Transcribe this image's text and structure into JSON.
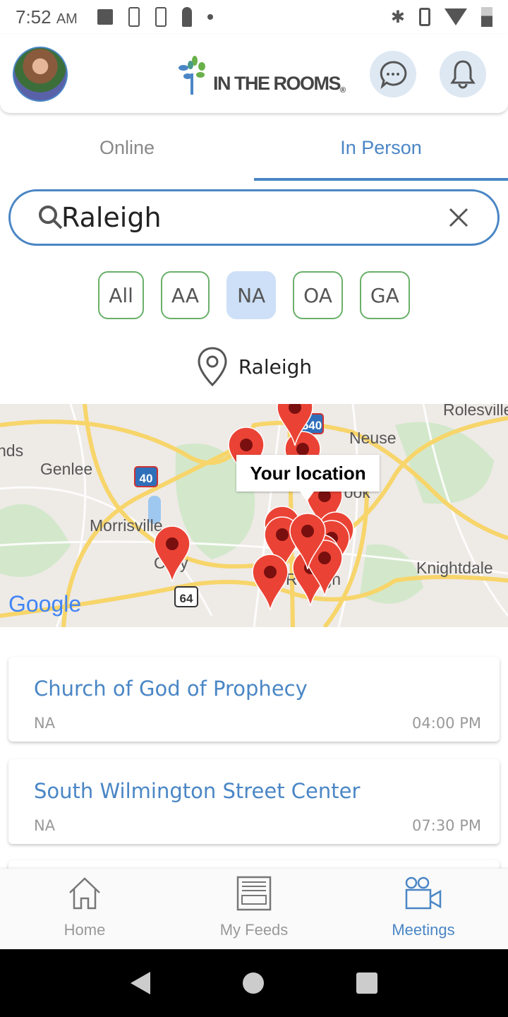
{
  "status_bar": {
    "time": "7:52",
    "ampm": "AM"
  },
  "header": {
    "logo_text": "IN THE ROOMS",
    "logo_mark": "®"
  },
  "tabs": [
    {
      "label": "Online",
      "active": false
    },
    {
      "label": "In Person",
      "active": true
    }
  ],
  "search": {
    "value": "Raleigh",
    "placeholder": ""
  },
  "filters": [
    {
      "label": "All",
      "selected": false
    },
    {
      "label": "AA",
      "selected": false
    },
    {
      "label": "NA",
      "selected": true
    },
    {
      "label": "OA",
      "selected": false
    },
    {
      "label": "GA",
      "selected": false
    }
  ],
  "location": {
    "label": "Raleigh"
  },
  "map": {
    "tooltip": "Your location",
    "places": [
      "Rolesville",
      "Neuse",
      "nds",
      "Genlee",
      "Morrisville",
      "Cary",
      "rook",
      "Raleigh",
      "Knightdale"
    ],
    "shields": [
      "540",
      "40",
      "64"
    ],
    "attribution": "Google",
    "pin_color": "#ea4335"
  },
  "meetings": [
    {
      "name": "Church of God of Prophecy",
      "fellowship": "NA",
      "time": "04:00 PM"
    },
    {
      "name": "South Wilmington Street Center",
      "fellowship": "NA",
      "time": "07:30 PM"
    }
  ],
  "bottom_nav": [
    {
      "label": "Home",
      "icon": "home-icon",
      "active": false
    },
    {
      "label": "My Feeds",
      "icon": "feeds-icon",
      "active": false
    },
    {
      "label": "Meetings",
      "icon": "video-camera-icon",
      "active": true
    }
  ],
  "colors": {
    "accent": "#4a86c5",
    "chip_border": "#6ab06a",
    "chip_selected": "#cde0f7"
  }
}
